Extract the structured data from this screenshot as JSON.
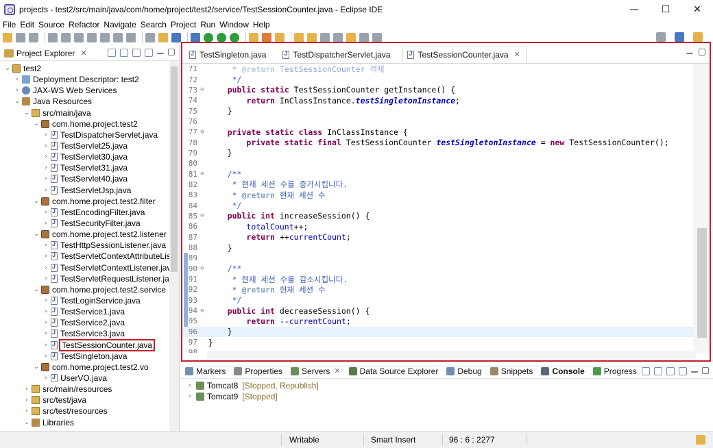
{
  "window": {
    "title": "projects - test2/src/main/java/com/home/project/test2/service/TestSessionCounter.java - Eclipse IDE",
    "minimize": "—",
    "maximize": "☐",
    "close": "✕"
  },
  "menu": [
    "File",
    "Edit",
    "Source",
    "Refactor",
    "Navigate",
    "Search",
    "Project",
    "Run",
    "Window",
    "Help"
  ],
  "explorer": {
    "tab_label": "Project Explorer",
    "tree": [
      {
        "label": "test2",
        "indent": 0,
        "twisty": "v",
        "icon": "project"
      },
      {
        "label": "Deployment Descriptor: test2",
        "indent": 1,
        "twisty": ">",
        "icon": "dd"
      },
      {
        "label": "JAX-WS Web Services",
        "indent": 1,
        "twisty": ">",
        "icon": "ws"
      },
      {
        "label": "Java Resources",
        "indent": 1,
        "twisty": "v",
        "icon": "jr"
      },
      {
        "label": "src/main/java",
        "indent": 2,
        "twisty": "v",
        "icon": "src"
      },
      {
        "label": "com.home.project.test2",
        "indent": 3,
        "twisty": "v",
        "icon": "pkg"
      },
      {
        "label": "TestDispatcherServlet.java",
        "indent": 4,
        "twisty": ">",
        "icon": "java"
      },
      {
        "label": "TestServlet25.java",
        "indent": 4,
        "twisty": ">",
        "icon": "java"
      },
      {
        "label": "TestServlet30.java",
        "indent": 4,
        "twisty": ">",
        "icon": "java"
      },
      {
        "label": "TestServlet31.java",
        "indent": 4,
        "twisty": ">",
        "icon": "java"
      },
      {
        "label": "TestServlet40.java",
        "indent": 4,
        "twisty": ">",
        "icon": "java"
      },
      {
        "label": "TestServletJsp.java",
        "indent": 4,
        "twisty": ">",
        "icon": "java"
      },
      {
        "label": "com.home.project.test2.filter",
        "indent": 3,
        "twisty": "v",
        "icon": "pkg"
      },
      {
        "label": "TestEncodingFilter.java",
        "indent": 4,
        "twisty": ">",
        "icon": "java"
      },
      {
        "label": "TestSecurityFilter.java",
        "indent": 4,
        "twisty": ">",
        "icon": "java"
      },
      {
        "label": "com.home.project.test2.listener",
        "indent": 3,
        "twisty": "v",
        "icon": "pkg"
      },
      {
        "label": "TestHttpSessionListener.java",
        "indent": 4,
        "twisty": ">",
        "icon": "java"
      },
      {
        "label": "TestServletContextAttributeListe",
        "indent": 4,
        "twisty": ">",
        "icon": "java"
      },
      {
        "label": "TestServletContextListener.java",
        "indent": 4,
        "twisty": ">",
        "icon": "java"
      },
      {
        "label": "TestServletRequestListener.java",
        "indent": 4,
        "twisty": ">",
        "icon": "java"
      },
      {
        "label": "com.home.project.test2.service",
        "indent": 3,
        "twisty": "v",
        "icon": "pkg"
      },
      {
        "label": "TestLoginService.java",
        "indent": 4,
        "twisty": ">",
        "icon": "java"
      },
      {
        "label": "TestService1.java",
        "indent": 4,
        "twisty": ">",
        "icon": "java"
      },
      {
        "label": "TestService2.java",
        "indent": 4,
        "twisty": ">",
        "icon": "java"
      },
      {
        "label": "TestService3.java",
        "indent": 4,
        "twisty": ">",
        "icon": "java"
      },
      {
        "label": "TestSessionCounter.java",
        "indent": 4,
        "twisty": ">",
        "icon": "java",
        "selected": true
      },
      {
        "label": "TestSingleton.java",
        "indent": 4,
        "twisty": ">",
        "icon": "java"
      },
      {
        "label": "com.home.project.test2.vo",
        "indent": 3,
        "twisty": "v",
        "icon": "pkg"
      },
      {
        "label": "UserVO.java",
        "indent": 4,
        "twisty": ">",
        "icon": "java"
      },
      {
        "label": "src/main/resources",
        "indent": 2,
        "twisty": ">",
        "icon": "src"
      },
      {
        "label": "src/test/java",
        "indent": 2,
        "twisty": ">",
        "icon": "src"
      },
      {
        "label": "src/test/resources",
        "indent": 2,
        "twisty": ">",
        "icon": "src"
      },
      {
        "label": "Libraries",
        "indent": 2,
        "twisty": "v",
        "icon": "jr"
      }
    ]
  },
  "editor": {
    "tabs": [
      {
        "label": "TestSingleton.java",
        "active": false
      },
      {
        "label": "TestDispatcherServlet.java",
        "active": false
      },
      {
        "label": "TestSessionCounter.java",
        "active": true
      }
    ],
    "lines": [
      {
        "n": "71",
        "fold": "",
        "html": "     <span class=\"jd fade\">* <span class=\"tag\">@return</span> TestSessionCounter 객체</span>"
      },
      {
        "n": "72",
        "fold": "",
        "html": "     <span class=\"jd\">*/</span>"
      },
      {
        "n": "73",
        "fold": "⊖",
        "html": "    <span class=\"kw\">public static</span> TestSessionCounter getInstance() {"
      },
      {
        "n": "74",
        "fold": "",
        "html": "        <span class=\"kw\">return</span> InClassInstance.<span class=\"sfld\">testSingletonInstance</span>;"
      },
      {
        "n": "75",
        "fold": "",
        "html": "    }"
      },
      {
        "n": "76",
        "fold": "",
        "html": ""
      },
      {
        "n": "77",
        "fold": "⊖",
        "html": "    <span class=\"kw\">private static class</span> InClassInstance {"
      },
      {
        "n": "78",
        "fold": "",
        "html": "        <span class=\"kw\">private static final</span> TestSessionCounter <span class=\"sfld\">testSingletonInstance</span> = <span class=\"kw\">new</span> TestSessionCounter();"
      },
      {
        "n": "79",
        "fold": "",
        "html": "    }"
      },
      {
        "n": "80",
        "fold": "",
        "html": ""
      },
      {
        "n": "81",
        "fold": "⊖",
        "html": "    <span class=\"jd\">/**</span>"
      },
      {
        "n": "82",
        "fold": "",
        "html": "     <span class=\"jd\">* 현재 세션 수를 증가시킵니다.</span>"
      },
      {
        "n": "83",
        "fold": "",
        "html": "     <span class=\"jd\">* <span class=\"tag\">@return</span> 현재 세션 수</span>"
      },
      {
        "n": "84",
        "fold": "",
        "html": "     <span class=\"jd\">*/</span>"
      },
      {
        "n": "85",
        "fold": "⊖",
        "html": "    <span class=\"kw\">public int</span> increaseSession() {"
      },
      {
        "n": "86",
        "fold": "",
        "html": "        <span class=\"fld\">totalCount</span>++;"
      },
      {
        "n": "87",
        "fold": "",
        "html": "        <span class=\"kw\">return</span> ++<span class=\"fld\">currentCount</span>;"
      },
      {
        "n": "88",
        "fold": "",
        "html": "    }"
      },
      {
        "n": "89",
        "fold": "",
        "html": ""
      },
      {
        "n": "90",
        "fold": "⊖",
        "html": "    <span class=\"jd\">/**</span>"
      },
      {
        "n": "91",
        "fold": "",
        "html": "     <span class=\"jd\">* 현재 세션 수를 감소시킵니다.</span>"
      },
      {
        "n": "92",
        "fold": "",
        "html": "     <span class=\"jd\">* <span class=\"tag\">@return</span> 현재 세션 수</span>"
      },
      {
        "n": "93",
        "fold": "",
        "html": "     <span class=\"jd\">*/</span>"
      },
      {
        "n": "94",
        "fold": "⊖",
        "html": "    <span class=\"kw\">public int</span> decreaseSession() {"
      },
      {
        "n": "95",
        "fold": "",
        "html": "        <span class=\"kw\">return</span> --<span class=\"fld\">currentCount</span>;"
      },
      {
        "n": "96",
        "fold": "",
        "html": "    }",
        "current": true
      },
      {
        "n": "97",
        "fold": "",
        "html": "}"
      },
      {
        "n": "98",
        "fold": "",
        "html": ""
      }
    ]
  },
  "bottom": {
    "tabs": [
      {
        "label": "Markers",
        "color": "#6f8fb3"
      },
      {
        "label": "Properties",
        "color": "#8a8a8a"
      },
      {
        "label": "Servers",
        "color": "#6c8f5a",
        "closable": true
      },
      {
        "label": "Data Source Explorer",
        "color": "#5a7a4a"
      },
      {
        "label": "Debug",
        "color": "#6f8fb3"
      },
      {
        "label": "Snippets",
        "color": "#9a8a6a"
      },
      {
        "label": "Console",
        "color": "#5a6a7a",
        "bold": true
      },
      {
        "label": "Progress",
        "color": "#4a9a4a"
      }
    ],
    "servers": [
      {
        "name": "Tomcat8",
        "state": "[Stopped, Republish]"
      },
      {
        "name": "Tomcat9",
        "state": "[Stopped]"
      }
    ]
  },
  "status": {
    "writable": "Writable",
    "insert_mode": "Smart Insert",
    "position": "96 : 6 : 2277"
  }
}
